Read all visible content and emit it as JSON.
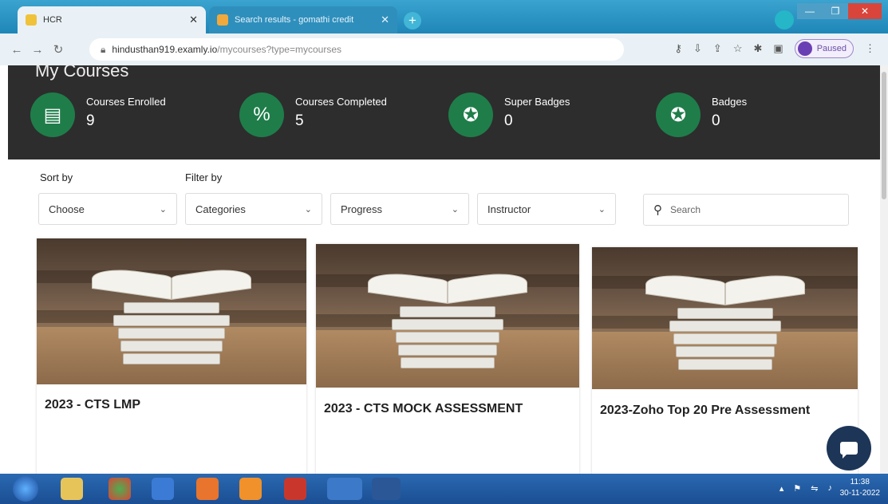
{
  "browser": {
    "tabs": [
      {
        "title": "HCR",
        "active": true
      },
      {
        "title": "Search results - gomathi credit",
        "active": false
      }
    ],
    "new_tab_label": "+",
    "address": {
      "host": "hindusthan919.examly.io",
      "path": "/mycourses?type=mycourses"
    },
    "profile_status": "Paused"
  },
  "page": {
    "title": "My Courses",
    "stats": [
      {
        "label": "Courses Enrolled",
        "value": "9",
        "icon": "courses-enrolled-icon"
      },
      {
        "label": "Courses Completed",
        "value": "5",
        "icon": "percent-icon"
      },
      {
        "label": "Super Badges",
        "value": "0",
        "icon": "super-badge-icon"
      },
      {
        "label": "Badges",
        "value": "0",
        "icon": "badge-icon"
      }
    ],
    "sort_label": "Sort by",
    "filter_label": "Filter by",
    "sort_select": "Choose",
    "filters": [
      "Categories",
      "Progress",
      "Instructor"
    ],
    "search_placeholder": "Search",
    "courses": [
      {
        "title": "2023 - CTS LMP"
      },
      {
        "title": "2023 - CTS MOCK ASSESSMENT"
      },
      {
        "title": "2023-Zoho Top 20 Pre Assessment"
      }
    ]
  },
  "taskbar": {
    "time": "11:38",
    "date": "30-11-2022"
  },
  "colors": {
    "hero_bg": "#2d2d2d",
    "stat_circle": "#1f7d4a",
    "chat_button": "#1d3557",
    "tabstrip": "#2a8fc0"
  }
}
